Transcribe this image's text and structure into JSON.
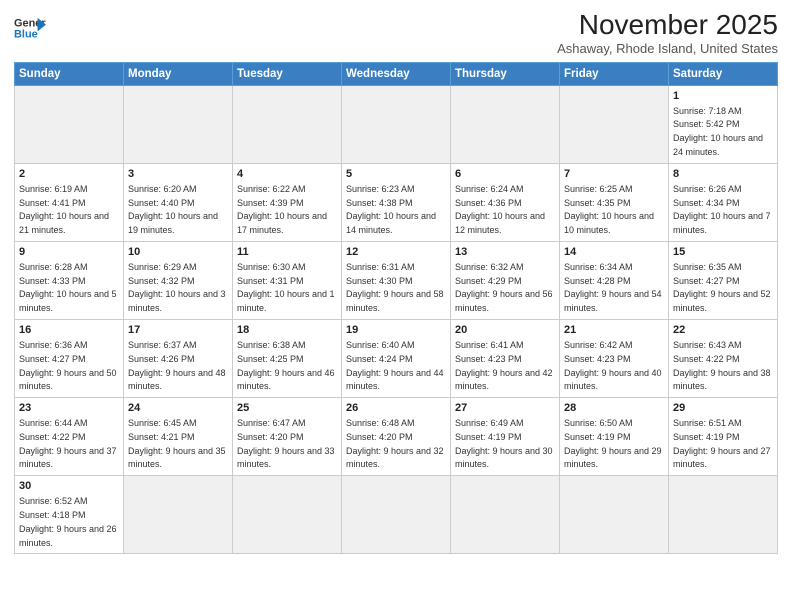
{
  "logo": {
    "line1": "General",
    "line2": "Blue"
  },
  "title": "November 2025",
  "subtitle": "Ashaway, Rhode Island, United States",
  "headers": [
    "Sunday",
    "Monday",
    "Tuesday",
    "Wednesday",
    "Thursday",
    "Friday",
    "Saturday"
  ],
  "weeks": [
    [
      {
        "day": "",
        "info": ""
      },
      {
        "day": "",
        "info": ""
      },
      {
        "day": "",
        "info": ""
      },
      {
        "day": "",
        "info": ""
      },
      {
        "day": "",
        "info": ""
      },
      {
        "day": "",
        "info": ""
      },
      {
        "day": "1",
        "info": "Sunrise: 7:18 AM\nSunset: 5:42 PM\nDaylight: 10 hours and 24 minutes."
      }
    ],
    [
      {
        "day": "2",
        "info": "Sunrise: 6:19 AM\nSunset: 4:41 PM\nDaylight: 10 hours and 21 minutes."
      },
      {
        "day": "3",
        "info": "Sunrise: 6:20 AM\nSunset: 4:40 PM\nDaylight: 10 hours and 19 minutes."
      },
      {
        "day": "4",
        "info": "Sunrise: 6:22 AM\nSunset: 4:39 PM\nDaylight: 10 hours and 17 minutes."
      },
      {
        "day": "5",
        "info": "Sunrise: 6:23 AM\nSunset: 4:38 PM\nDaylight: 10 hours and 14 minutes."
      },
      {
        "day": "6",
        "info": "Sunrise: 6:24 AM\nSunset: 4:36 PM\nDaylight: 10 hours and 12 minutes."
      },
      {
        "day": "7",
        "info": "Sunrise: 6:25 AM\nSunset: 4:35 PM\nDaylight: 10 hours and 10 minutes."
      },
      {
        "day": "8",
        "info": "Sunrise: 6:26 AM\nSunset: 4:34 PM\nDaylight: 10 hours and 7 minutes."
      }
    ],
    [
      {
        "day": "9",
        "info": "Sunrise: 6:28 AM\nSunset: 4:33 PM\nDaylight: 10 hours and 5 minutes."
      },
      {
        "day": "10",
        "info": "Sunrise: 6:29 AM\nSunset: 4:32 PM\nDaylight: 10 hours and 3 minutes."
      },
      {
        "day": "11",
        "info": "Sunrise: 6:30 AM\nSunset: 4:31 PM\nDaylight: 10 hours and 1 minute."
      },
      {
        "day": "12",
        "info": "Sunrise: 6:31 AM\nSunset: 4:30 PM\nDaylight: 9 hours and 58 minutes."
      },
      {
        "day": "13",
        "info": "Sunrise: 6:32 AM\nSunset: 4:29 PM\nDaylight: 9 hours and 56 minutes."
      },
      {
        "day": "14",
        "info": "Sunrise: 6:34 AM\nSunset: 4:28 PM\nDaylight: 9 hours and 54 minutes."
      },
      {
        "day": "15",
        "info": "Sunrise: 6:35 AM\nSunset: 4:27 PM\nDaylight: 9 hours and 52 minutes."
      }
    ],
    [
      {
        "day": "16",
        "info": "Sunrise: 6:36 AM\nSunset: 4:27 PM\nDaylight: 9 hours and 50 minutes."
      },
      {
        "day": "17",
        "info": "Sunrise: 6:37 AM\nSunset: 4:26 PM\nDaylight: 9 hours and 48 minutes."
      },
      {
        "day": "18",
        "info": "Sunrise: 6:38 AM\nSunset: 4:25 PM\nDaylight: 9 hours and 46 minutes."
      },
      {
        "day": "19",
        "info": "Sunrise: 6:40 AM\nSunset: 4:24 PM\nDaylight: 9 hours and 44 minutes."
      },
      {
        "day": "20",
        "info": "Sunrise: 6:41 AM\nSunset: 4:23 PM\nDaylight: 9 hours and 42 minutes."
      },
      {
        "day": "21",
        "info": "Sunrise: 6:42 AM\nSunset: 4:23 PM\nDaylight: 9 hours and 40 minutes."
      },
      {
        "day": "22",
        "info": "Sunrise: 6:43 AM\nSunset: 4:22 PM\nDaylight: 9 hours and 38 minutes."
      }
    ],
    [
      {
        "day": "23",
        "info": "Sunrise: 6:44 AM\nSunset: 4:22 PM\nDaylight: 9 hours and 37 minutes."
      },
      {
        "day": "24",
        "info": "Sunrise: 6:45 AM\nSunset: 4:21 PM\nDaylight: 9 hours and 35 minutes."
      },
      {
        "day": "25",
        "info": "Sunrise: 6:47 AM\nSunset: 4:20 PM\nDaylight: 9 hours and 33 minutes."
      },
      {
        "day": "26",
        "info": "Sunrise: 6:48 AM\nSunset: 4:20 PM\nDaylight: 9 hours and 32 minutes."
      },
      {
        "day": "27",
        "info": "Sunrise: 6:49 AM\nSunset: 4:19 PM\nDaylight: 9 hours and 30 minutes."
      },
      {
        "day": "28",
        "info": "Sunrise: 6:50 AM\nSunset: 4:19 PM\nDaylight: 9 hours and 29 minutes."
      },
      {
        "day": "29",
        "info": "Sunrise: 6:51 AM\nSunset: 4:19 PM\nDaylight: 9 hours and 27 minutes."
      }
    ],
    [
      {
        "day": "30",
        "info": "Sunrise: 6:52 AM\nSunset: 4:18 PM\nDaylight: 9 hours and 26 minutes."
      },
      {
        "day": "",
        "info": ""
      },
      {
        "day": "",
        "info": ""
      },
      {
        "day": "",
        "info": ""
      },
      {
        "day": "",
        "info": ""
      },
      {
        "day": "",
        "info": ""
      },
      {
        "day": "",
        "info": ""
      }
    ]
  ]
}
